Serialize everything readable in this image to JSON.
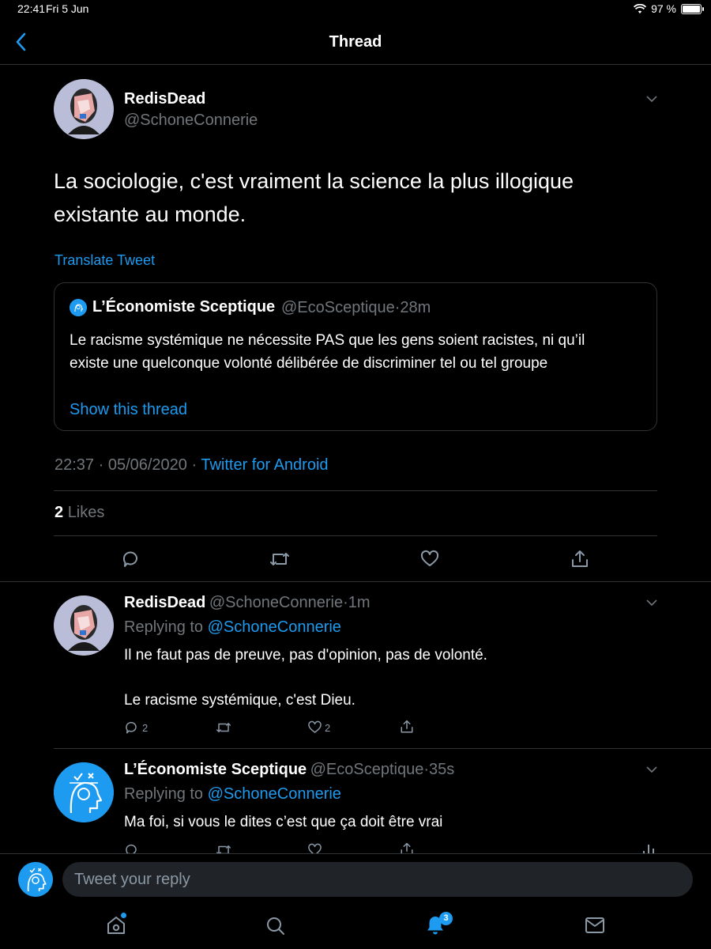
{
  "status_bar": {
    "time": "22:41",
    "date": "Fri 5 Jun",
    "battery": "97 %"
  },
  "header": {
    "title": "Thread"
  },
  "main_tweet": {
    "display_name": "RedisDead",
    "handle": "@SchoneConnerie",
    "text": "La sociologie, c'est vraiment la science la plus illogique existante au monde.",
    "translate": "Translate Tweet",
    "quoted": {
      "display_name": "L’Économiste Sceptique",
      "handle": "@EcoSceptique",
      "time": "28m",
      "text": "Le racisme systémique ne nécessite PAS que les gens soient racistes, ni qu’il existe une quelconque volonté délibérée de discriminer tel ou tel groupe",
      "show_thread": "Show this thread"
    },
    "timestamp": "22:37 · 05/06/2020 ·",
    "source": "Twitter for Android",
    "likes_count": "2",
    "likes_label": "Likes"
  },
  "replies": [
    {
      "display_name": "RedisDead",
      "handle": "@SchoneConnerie",
      "time": "1m",
      "replying_to_label": "Replying to",
      "replying_to": "@SchoneConnerie",
      "text_line1": "Il ne faut pas de preuve, pas d'opinion, pas de volonté.",
      "text_line2": "Le racisme systémique, c'est Dieu.",
      "reply_count": "2",
      "like_count": "2"
    },
    {
      "display_name": "L’Économiste Sceptique",
      "handle": "@EcoSceptique",
      "time": "35s",
      "replying_to_label": "Replying to",
      "replying_to": "@SchoneConnerie",
      "text_line1": "Ma foi, si vous le dites c’est que ça doit être vrai"
    }
  ],
  "reply_bar": {
    "placeholder": "Tweet your reply"
  },
  "tab_bar": {
    "notifications_badge": "3"
  },
  "colors": {
    "accent": "#1d9bf0",
    "background": "#000000",
    "divider": "#2f3336",
    "muted": "#71767b"
  },
  "icons": [
    "back-chevron-icon",
    "wifi-icon",
    "battery-icon",
    "caret-down-icon",
    "reply-icon",
    "retweet-icon",
    "like-icon",
    "share-icon",
    "analytics-icon",
    "home-icon",
    "search-icon",
    "notifications-icon",
    "messages-icon"
  ]
}
